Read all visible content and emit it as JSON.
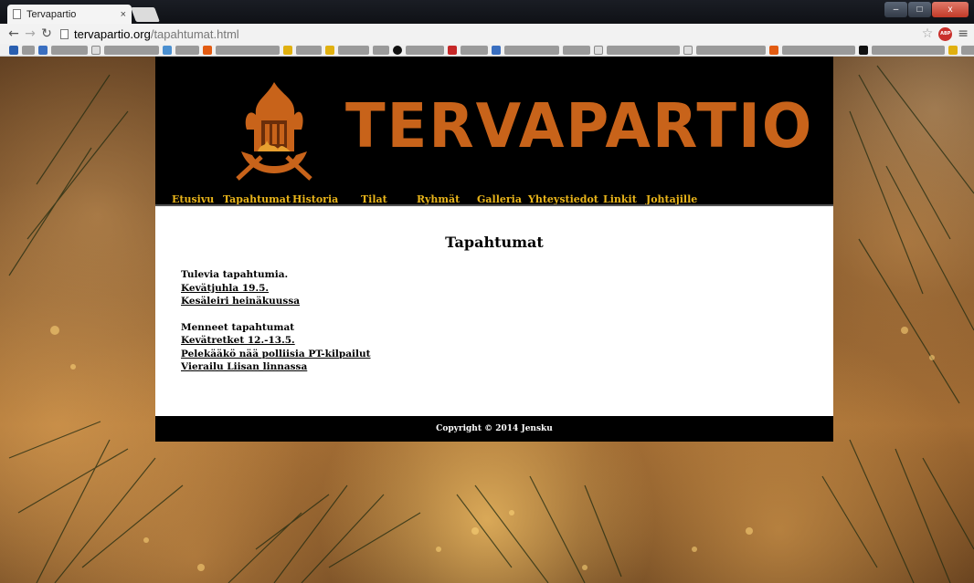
{
  "browser": {
    "tab_title": "Tervapartio",
    "tab_close": "×",
    "url_host": "tervapartio.org",
    "url_path": "/tapahtumat.html",
    "back_icon": "back-arrow-icon",
    "forward_icon": "forward-arrow-icon",
    "reload_icon": "reload-icon",
    "window_buttons": [
      "–",
      "□",
      "x"
    ]
  },
  "site": {
    "title": "TERVAPARTIO",
    "title_color": "#c8631a",
    "nav_color": "#e8b41a",
    "nav": [
      {
        "label": "Etusivu"
      },
      {
        "label": "Tapahtumat"
      },
      {
        "label": "Historia"
      },
      {
        "label": "Tilat"
      },
      {
        "label": "Ryhmät"
      },
      {
        "label": "Galleria"
      },
      {
        "label": "Yhteystiedot"
      },
      {
        "label": "Linkit"
      },
      {
        "label": "Johtajille"
      }
    ],
    "heading": "Tapahtumat",
    "upcoming": {
      "title": "Tulevia tapahtumia.",
      "links": [
        "Kevätjuhla 19.5.",
        "Kesäleiri heinäkuussa"
      ]
    },
    "past": {
      "title": "Menneet tapahtumat",
      "links": [
        "Kevätretket 12.-13.5.",
        "Pelekääkö nää polliisia PT-kilpailut",
        "Vierailu Liisan linnassa"
      ]
    },
    "footer": "Copyright © 2014 Jensku"
  }
}
